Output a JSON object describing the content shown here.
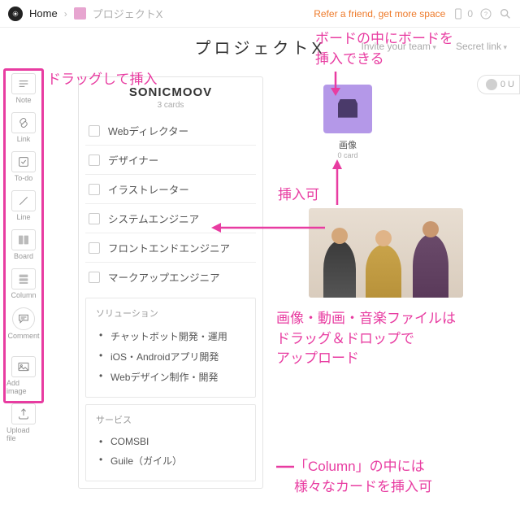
{
  "header": {
    "home": "Home",
    "project_name": "プロジェクトX",
    "refer": "Refer a friend, get more space",
    "device_count": "0"
  },
  "title": "プロジェクトX",
  "title_ops": {
    "invite": "Invite your team",
    "secret": "Secret link"
  },
  "toolbar": [
    {
      "id": "note",
      "label": "Note"
    },
    {
      "id": "link",
      "label": "Link"
    },
    {
      "id": "todo",
      "label": "To-do"
    },
    {
      "id": "line",
      "label": "Line"
    },
    {
      "id": "board",
      "label": "Board"
    },
    {
      "id": "column",
      "label": "Column"
    },
    {
      "id": "comment",
      "label": "Comment"
    },
    {
      "id": "addimage",
      "label": "Add image"
    },
    {
      "id": "uploadfile",
      "label": "Upload file"
    }
  ],
  "column": {
    "title": "SONICMOOV",
    "subtitle": "3 cards",
    "todos": [
      "Webディレクター",
      "デザイナー",
      "イラストレーター",
      "システムエンジニア",
      "フロントエンドエンジニア",
      "マークアップエンジニア"
    ],
    "sections": [
      {
        "heading": "ソリューション",
        "items": [
          "チャットボット開発・運用",
          "iOS・Androidアプリ開発",
          "Webデザイン制作・開発"
        ]
      },
      {
        "heading": "サービス",
        "items": [
          "COMSBI",
          "Guile（ガイル）"
        ]
      }
    ]
  },
  "board_thumb": {
    "label": "画像",
    "count": "0 card"
  },
  "badge": "0 U",
  "annotations": {
    "drag_insert": "ドラッグして挿入",
    "board_in_board": "ボードの中にボードを\n挿入できる",
    "insertable": "挿入可",
    "media_upload": "画像・動画・音楽ファイルは\nドラッグ＆ドロップで\nアップロード",
    "column_note": "「Column」の中には\n様々なカードを挿入可"
  }
}
